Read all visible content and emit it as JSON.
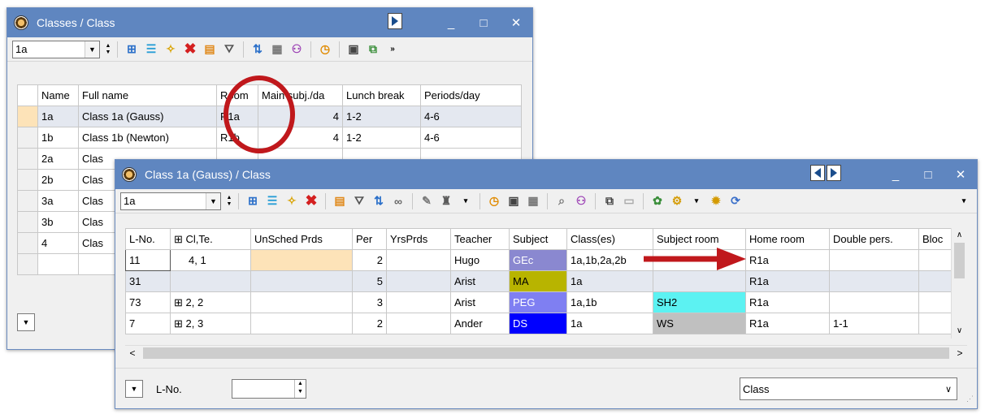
{
  "back_window": {
    "title": "Classes / Class",
    "class_combo_value": "1a",
    "columns": [
      "",
      "Name",
      "Full name",
      "Room",
      "Main subj./da",
      "Lunch break",
      "Periods/day"
    ],
    "rows": [
      {
        "name": "1a",
        "full": "Class 1a (Gauss)",
        "room": "R1a",
        "main": "4",
        "lunch": "1-2",
        "periods": "4-6",
        "selected": true
      },
      {
        "name": "1b",
        "full": "Class 1b (Newton)",
        "room": "R1b",
        "main": "4",
        "lunch": "1-2",
        "periods": "4-6"
      },
      {
        "name": "2a",
        "full": "Clas",
        "room": "",
        "main": "",
        "lunch": "",
        "periods": ""
      },
      {
        "name": "2b",
        "full": "Clas",
        "room": "",
        "main": "",
        "lunch": "",
        "periods": ""
      },
      {
        "name": "3a",
        "full": "Clas",
        "room": "",
        "main": "",
        "lunch": "",
        "periods": ""
      },
      {
        "name": "3b",
        "full": "Clas",
        "room": "",
        "main": "",
        "lunch": "",
        "periods": ""
      },
      {
        "name": "4",
        "full": "Clas",
        "room": "",
        "main": "",
        "lunch": "",
        "periods": ""
      }
    ]
  },
  "front_window": {
    "title": "Class 1a (Gauss) / Class",
    "class_combo_value": "1a",
    "columns": [
      "L-No.",
      "⊞ Cl,Te.",
      "UnSched Prds",
      "Per",
      "YrsPrds",
      "Teacher",
      "Subject",
      "Class(es)",
      "Subject room",
      "Home room",
      "Double pers.",
      "Bloc"
    ],
    "rows": [
      {
        "lno": "11",
        "clte": "4, 1",
        "unsched": "",
        "per": "2",
        "yrs": "",
        "teacher": "Hugo",
        "subject": "GEc",
        "classes": "1a,1b,2a,2b",
        "sroom": "",
        "home": "R1a",
        "double": "",
        "bloc": ""
      },
      {
        "lno": "31",
        "clte": "",
        "unsched": "",
        "per": "5",
        "yrs": "",
        "teacher": "Arist",
        "subject": "MA",
        "classes": "1a",
        "sroom": "",
        "home": "R1a",
        "double": "",
        "bloc": ""
      },
      {
        "lno": "73",
        "clte": "⊞ 2, 2",
        "unsched": "",
        "per": "3",
        "yrs": "",
        "teacher": "Arist",
        "subject": "PEG",
        "classes": "1a,1b",
        "sroom": "SH2",
        "home": "R1a",
        "double": "",
        "bloc": ""
      },
      {
        "lno": "7",
        "clte": "⊞ 2, 3",
        "unsched": "",
        "per": "2",
        "yrs": "",
        "teacher": "Ander",
        "subject": "DS",
        "classes": "1a",
        "sroom": "WS",
        "home": "R1a",
        "double": "1-1",
        "bloc": ""
      }
    ],
    "status_label": "L-No.",
    "lno_input_value": "",
    "bottom_combo_value": "Class"
  },
  "colors": {
    "titlebar": "#5f86c0",
    "subj_GEc": "#8a88d0",
    "subj_MA": "#b8b400",
    "subj_PEG": "#7f7ff2",
    "subj_DS": "#0000ff",
    "sroom_SH2": "#5cf2f2",
    "sroom_WS": "#c0c0c0",
    "unsched_highlight": "#fde3b8",
    "annotation_red": "#c0181c"
  }
}
